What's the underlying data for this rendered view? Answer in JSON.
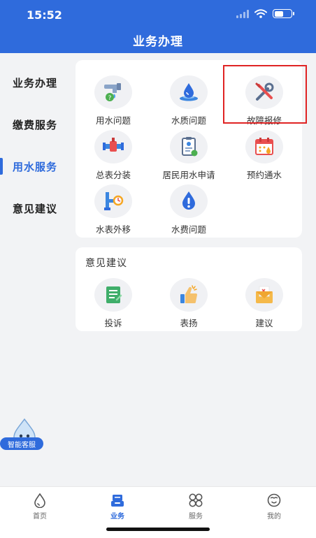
{
  "status_bar": {
    "time": "15:52"
  },
  "header": {
    "title": "业务办理"
  },
  "sidebar": {
    "items": [
      {
        "label": "业务办理"
      },
      {
        "label": "缴费服务"
      },
      {
        "label": "用水服务",
        "active": true
      },
      {
        "label": "意见建议"
      }
    ]
  },
  "water_service": {
    "items": [
      {
        "label": "用水问题",
        "icon": "water-tap-question-icon"
      },
      {
        "label": "水质问题",
        "icon": "water-drop-icon"
      },
      {
        "label": "故障报修",
        "icon": "wrench-screwdriver-icon"
      },
      {
        "label": "总表分装",
        "icon": "water-meter-pipe-icon"
      },
      {
        "label": "居民用水申请",
        "icon": "application-form-icon"
      },
      {
        "label": "预约通水",
        "icon": "calendar-water-icon"
      },
      {
        "label": "水表外移",
        "icon": "meter-relocation-icon"
      },
      {
        "label": "水费问题",
        "icon": "warning-drop-icon"
      }
    ]
  },
  "feedback": {
    "title": "意见建议",
    "items": [
      {
        "label": "投诉",
        "icon": "complaint-document-icon"
      },
      {
        "label": "表扬",
        "icon": "thumbs-up-icon"
      },
      {
        "label": "建议",
        "icon": "suggestion-envelope-icon"
      }
    ]
  },
  "assistant": {
    "label": "智能客服"
  },
  "tabbar": {
    "items": [
      {
        "label": "首页",
        "icon": "home-drop-icon"
      },
      {
        "label": "业务",
        "icon": "business-tray-icon",
        "active": true
      },
      {
        "label": "服务",
        "icon": "services-grid-icon"
      },
      {
        "label": "我的",
        "icon": "profile-face-icon"
      }
    ]
  },
  "colors": {
    "primary": "#2f6bdc",
    "highlight": "#e02424",
    "background": "#f2f3f5"
  }
}
